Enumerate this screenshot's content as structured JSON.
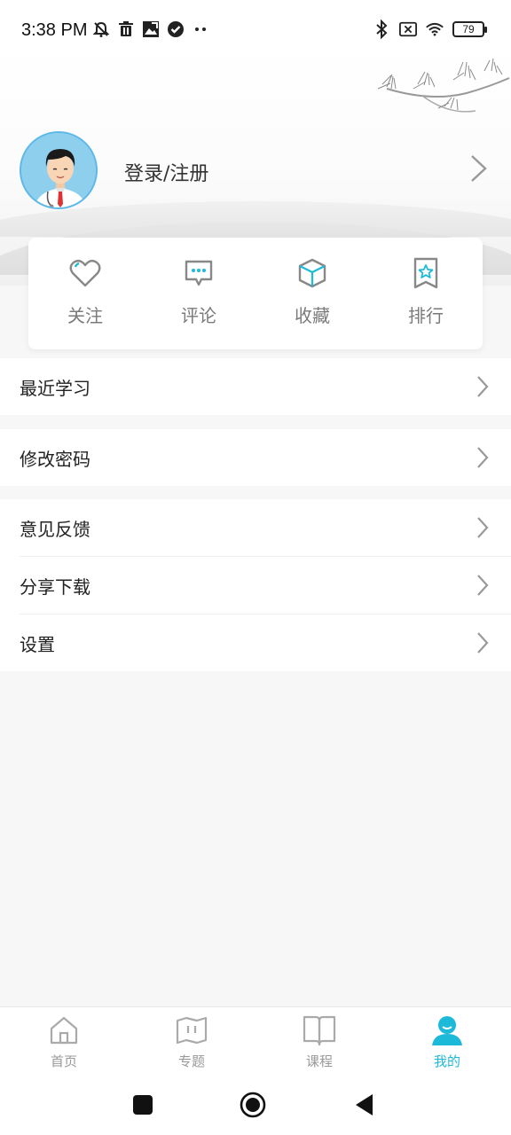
{
  "status_bar": {
    "time": "3:38 PM",
    "battery": "79",
    "icons_left": [
      "mute-icon",
      "trash-icon",
      "image-icon",
      "check-circle-icon",
      "more-dots-icon"
    ],
    "icons_right": [
      "bluetooth-icon",
      "no-sim-icon",
      "wifi-icon",
      "battery-icon"
    ]
  },
  "profile": {
    "login_label": "登录/注册",
    "avatar_icon": "doctor-avatar"
  },
  "shortcuts": [
    {
      "label": "关注",
      "icon": "heart-icon"
    },
    {
      "label": "评论",
      "icon": "comment-icon"
    },
    {
      "label": "收藏",
      "icon": "cube-icon"
    },
    {
      "label": "排行",
      "icon": "star-bookmark-icon"
    }
  ],
  "menu": {
    "recent": "最近学习",
    "change_password": "修改密码",
    "feedback": "意见反馈",
    "share_download": "分享下载",
    "settings": "设置"
  },
  "tabs": [
    {
      "label": "首页",
      "icon": "home-icon"
    },
    {
      "label": "专题",
      "icon": "map-icon"
    },
    {
      "label": "课程",
      "icon": "book-icon"
    },
    {
      "label": "我的",
      "icon": "user-icon",
      "active": true
    }
  ],
  "colors": {
    "accent": "#1cb9d8",
    "inactive": "#999999"
  }
}
